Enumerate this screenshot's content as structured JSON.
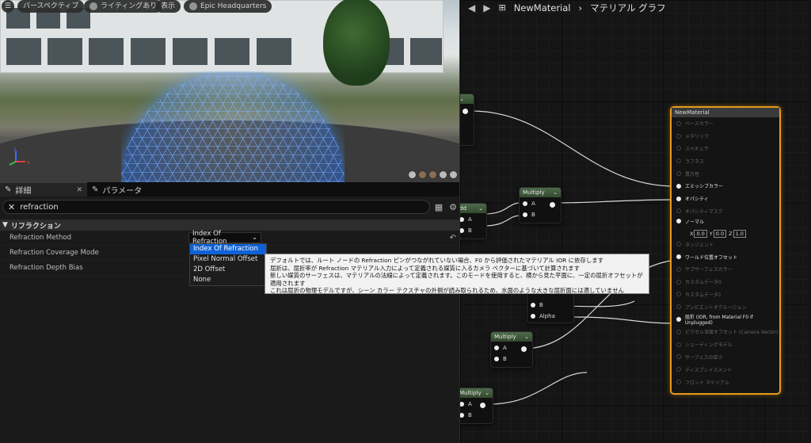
{
  "viewport": {
    "menu_icon": "hamburger-icon",
    "buttons": [
      "パースペクティブ",
      "ライティングあり",
      "表示",
      "Epic Headquarters"
    ]
  },
  "details": {
    "tabs": [
      {
        "label": "詳細",
        "icon": "pencil-icon",
        "close": "✕"
      },
      {
        "label": "パラメータ",
        "icon": "pencil-icon"
      }
    ],
    "search_value": "refraction",
    "section": "リフラクション",
    "properties": [
      {
        "label": "Refraction Method",
        "value": "Index Of Refraction"
      },
      {
        "label": "Refraction Coverage Mode",
        "value": ""
      },
      {
        "label": "Refraction Depth Bias",
        "value": ""
      }
    ],
    "dropdown_options": [
      "Index Of Refraction",
      "Pixel Normal Offset",
      "2D Offset",
      "None"
    ],
    "dropdown_selected": "Index Of Refraction",
    "tooltip_lines": [
      "デフォルトでは、ルート ノードの Refraction ピンがつながれていない場合、F0 から評価されたマテリアル IOR に依存します",
      "屈折は、屈折率が Refraction マテリアル入力によって定義される媒質に入るカメラ ベクターに基づいて計算されます",
      "新しい媒質のサーフェスは、マテリアルの法線によって定義されます。このモードを使用すると、横から見た平面に、一定の屈折オフセットが適用されます",
      "これは屈折の物理モデルですが、シーン カラー テクスチャの外側が読み取られるため、水面のような大きな屈折面には適していません"
    ]
  },
  "graph": {
    "breadcrumb": [
      "NewMaterial",
      "マテリアル グラフ"
    ],
    "nodes": [
      {
        "title": "Multiply",
        "pins": [
          "A",
          "B"
        ]
      },
      {
        "title": "Multiply",
        "pins": [
          "A",
          "B"
        ]
      },
      {
        "title": "Multiply",
        "pins": [
          "A",
          "B"
        ]
      },
      {
        "title": "dd",
        "pins": [
          "A",
          "B"
        ]
      }
    ],
    "partial_pins": [
      "B",
      "Alpha"
    ],
    "material": {
      "title": "NewMaterial",
      "pins": [
        {
          "label": "ベースカラー",
          "on": false
        },
        {
          "label": "メタリック",
          "on": false
        },
        {
          "label": "スペキュラ",
          "on": false
        },
        {
          "label": "ラフネス",
          "on": false
        },
        {
          "label": "異方性",
          "on": false
        },
        {
          "label": "エミッシブカラー",
          "on": true
        },
        {
          "label": "オパシティ",
          "on": true
        },
        {
          "label": "オパシティマスク",
          "on": false
        },
        {
          "label": "ノーマル",
          "on": true
        },
        {
          "label": "タンジェント",
          "on": false
        },
        {
          "label": "ワールド位置オフセット",
          "on": true
        },
        {
          "label": "サブサーフェスカラー",
          "on": false
        },
        {
          "label": "カスタムデータ0",
          "on": false
        },
        {
          "label": "カスタムデータ1",
          "on": false
        },
        {
          "label": "アンビエントオクルージョン",
          "on": false
        },
        {
          "label": "屈折 (IOR, from Material F0 if Unplugged)",
          "on": true
        },
        {
          "label": "ピクセル深度オフセット (Camera Vector)",
          "on": false
        },
        {
          "label": "シェーディングモデル",
          "on": false
        },
        {
          "label": "サーフェスの厚さ",
          "on": false
        },
        {
          "label": "ディスプレイスメント",
          "on": false
        },
        {
          "label": "フロント マテリアル",
          "on": false
        }
      ],
      "normal_vec": [
        "X",
        "0.0",
        "Y",
        "0.0",
        "Z",
        "1.0"
      ]
    }
  }
}
